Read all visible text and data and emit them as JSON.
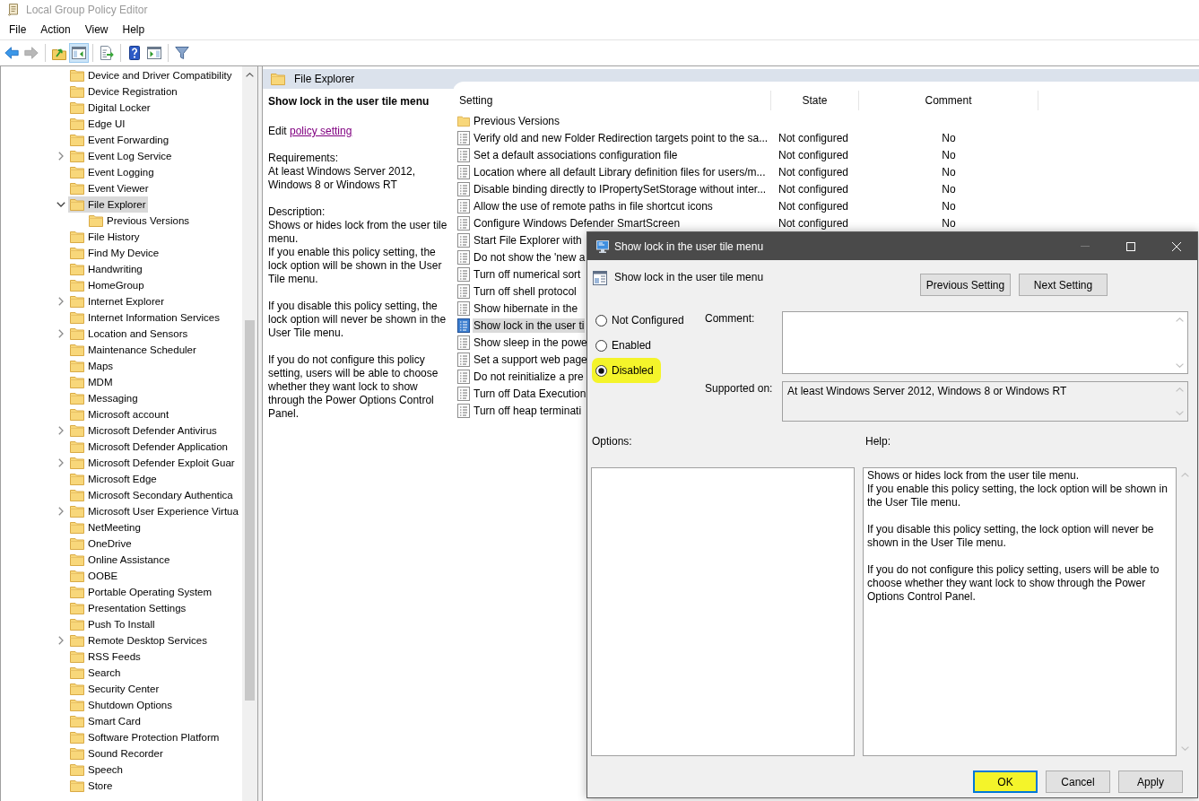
{
  "window": {
    "title": "Local Group Policy Editor"
  },
  "menu": [
    "File",
    "Action",
    "View",
    "Help"
  ],
  "toolbar": [
    {
      "buttons": [
        {
          "kind": "back",
          "pressed": false,
          "disabled": false
        },
        {
          "kind": "forward",
          "pressed": false,
          "disabled": true
        }
      ]
    },
    {
      "buttons": [
        {
          "kind": "up",
          "pressed": false,
          "disabled": false
        },
        {
          "kind": "console_tree",
          "pressed": true,
          "disabled": false
        }
      ]
    },
    {
      "buttons": [
        {
          "kind": "export",
          "pressed": false,
          "disabled": false
        }
      ]
    },
    {
      "buttons": [
        {
          "kind": "help",
          "pressed": false,
          "disabled": false
        },
        {
          "kind": "action_pane",
          "pressed": false,
          "disabled": false
        }
      ]
    },
    {
      "buttons": [
        {
          "kind": "filter",
          "pressed": false,
          "disabled": false
        }
      ]
    }
  ],
  "tree": {
    "items": [
      {
        "label": "Device and Driver Compatibility",
        "kind": "leaf",
        "expanded": false,
        "selected": false
      },
      {
        "label": "Device Registration",
        "kind": "leaf",
        "expanded": false,
        "selected": false
      },
      {
        "label": "Digital Locker",
        "kind": "leaf",
        "expanded": false,
        "selected": false
      },
      {
        "label": "Edge UI",
        "kind": "leaf",
        "expanded": false,
        "selected": false
      },
      {
        "label": "Event Forwarding",
        "kind": "leaf",
        "expanded": false,
        "selected": false
      },
      {
        "label": "Event Log Service",
        "kind": "branch",
        "expanded": false,
        "selected": false
      },
      {
        "label": "Event Logging",
        "kind": "leaf",
        "expanded": false,
        "selected": false
      },
      {
        "label": "Event Viewer",
        "kind": "leaf",
        "expanded": false,
        "selected": false
      },
      {
        "label": "File Explorer",
        "kind": "branch",
        "expanded": true,
        "selected": true,
        "children": [
          {
            "label": "Previous Versions",
            "kind": "leaf",
            "expanded": false,
            "selected": false
          }
        ]
      },
      {
        "label": "File History",
        "kind": "leaf",
        "expanded": false,
        "selected": false
      },
      {
        "label": "Find My Device",
        "kind": "leaf",
        "expanded": false,
        "selected": false
      },
      {
        "label": "Handwriting",
        "kind": "leaf",
        "expanded": false,
        "selected": false
      },
      {
        "label": "HomeGroup",
        "kind": "leaf",
        "expanded": false,
        "selected": false
      },
      {
        "label": "Internet Explorer",
        "kind": "branch",
        "expanded": false,
        "selected": false
      },
      {
        "label": "Internet Information Services",
        "kind": "leaf",
        "expanded": false,
        "selected": false
      },
      {
        "label": "Location and Sensors",
        "kind": "branch",
        "expanded": false,
        "selected": false
      },
      {
        "label": "Maintenance Scheduler",
        "kind": "leaf",
        "expanded": false,
        "selected": false
      },
      {
        "label": "Maps",
        "kind": "leaf",
        "expanded": false,
        "selected": false
      },
      {
        "label": "MDM",
        "kind": "leaf",
        "expanded": false,
        "selected": false
      },
      {
        "label": "Messaging",
        "kind": "leaf",
        "expanded": false,
        "selected": false
      },
      {
        "label": "Microsoft account",
        "kind": "leaf",
        "expanded": false,
        "selected": false
      },
      {
        "label": "Microsoft Defender Antivirus",
        "kind": "branch",
        "expanded": false,
        "selected": false
      },
      {
        "label": "Microsoft Defender Application",
        "kind": "leaf",
        "expanded": false,
        "selected": false
      },
      {
        "label": "Microsoft Defender Exploit Guar",
        "kind": "branch",
        "expanded": false,
        "selected": false
      },
      {
        "label": "Microsoft Edge",
        "kind": "leaf",
        "expanded": false,
        "selected": false
      },
      {
        "label": "Microsoft Secondary Authentica",
        "kind": "leaf",
        "expanded": false,
        "selected": false
      },
      {
        "label": "Microsoft User Experience Virtua",
        "kind": "branch",
        "expanded": false,
        "selected": false
      },
      {
        "label": "NetMeeting",
        "kind": "leaf",
        "expanded": false,
        "selected": false
      },
      {
        "label": "OneDrive",
        "kind": "leaf",
        "expanded": false,
        "selected": false
      },
      {
        "label": "Online Assistance",
        "kind": "leaf",
        "expanded": false,
        "selected": false
      },
      {
        "label": "OOBE",
        "kind": "leaf",
        "expanded": false,
        "selected": false
      },
      {
        "label": "Portable Operating System",
        "kind": "leaf",
        "expanded": false,
        "selected": false
      },
      {
        "label": "Presentation Settings",
        "kind": "leaf",
        "expanded": false,
        "selected": false
      },
      {
        "label": "Push To Install",
        "kind": "leaf",
        "expanded": false,
        "selected": false
      },
      {
        "label": "Remote Desktop Services",
        "kind": "branch",
        "expanded": false,
        "selected": false
      },
      {
        "label": "RSS Feeds",
        "kind": "leaf",
        "expanded": false,
        "selected": false
      },
      {
        "label": "Search",
        "kind": "leaf",
        "expanded": false,
        "selected": false
      },
      {
        "label": "Security Center",
        "kind": "leaf",
        "expanded": false,
        "selected": false
      },
      {
        "label": "Shutdown Options",
        "kind": "leaf",
        "expanded": false,
        "selected": false
      },
      {
        "label": "Smart Card",
        "kind": "leaf",
        "expanded": false,
        "selected": false
      },
      {
        "label": "Software Protection Platform",
        "kind": "leaf",
        "expanded": false,
        "selected": false
      },
      {
        "label": "Sound Recorder",
        "kind": "leaf",
        "expanded": false,
        "selected": false
      },
      {
        "label": "Speech",
        "kind": "leaf",
        "expanded": false,
        "selected": false
      },
      {
        "label": "Store",
        "kind": "leaf",
        "expanded": false,
        "selected": false
      }
    ]
  },
  "details": {
    "header": "File Explorer",
    "extended": {
      "title": "Show lock in the user tile menu",
      "edit_prefix": "Edit",
      "edit_link": "policy setting",
      "requirements_label": "Requirements:",
      "requirements": "At least Windows Server 2012, Windows 8 or Windows RT",
      "description_label": "Description:",
      "description": [
        [
          "Shows or hides lock from the user tile menu.",
          "If you enable this policy setting, the lock option will be shown in the User Tile menu."
        ],
        [
          "If you disable this policy setting, the lock option will never be shown in the User Tile menu."
        ],
        [
          "If you do not configure this policy setting, users will be able to choose whether they want lock to show through the Power Options Control Panel."
        ]
      ]
    },
    "list": {
      "columns": [
        "Setting",
        "State",
        "Comment"
      ],
      "rows": [
        {
          "kind": "folder",
          "name": "Previous Versions",
          "selected": false
        },
        {
          "kind": "policy",
          "name": "Verify old and new Folder Redirection targets point to the sa...",
          "state": "Not configured",
          "comment": "No",
          "selected": false
        },
        {
          "kind": "policy",
          "name": "Set a default associations configuration file",
          "state": "Not configured",
          "comment": "No",
          "selected": false
        },
        {
          "kind": "policy",
          "name": "Location where all default Library definition files for users/m...",
          "state": "Not configured",
          "comment": "No",
          "selected": false
        },
        {
          "kind": "policy",
          "name": "Disable binding directly to IPropertySetStorage without inter...",
          "state": "Not configured",
          "comment": "No",
          "selected": false
        },
        {
          "kind": "policy",
          "name": "Allow the use of remote paths in file shortcut icons",
          "state": "Not configured",
          "comment": "No",
          "selected": false
        },
        {
          "kind": "policy",
          "name": "Configure Windows Defender SmartScreen",
          "state": "Not configured",
          "comment": "No",
          "selected": false
        },
        {
          "kind": "policy",
          "name": "Start File Explorer with",
          "selected": false
        },
        {
          "kind": "policy",
          "name": "Do not show the 'new a",
          "selected": false
        },
        {
          "kind": "policy",
          "name": "Turn off numerical sort",
          "selected": false
        },
        {
          "kind": "policy",
          "name": "Turn off shell protocol",
          "selected": false
        },
        {
          "kind": "policy",
          "name": "Show hibernate in the",
          "selected": false
        },
        {
          "kind": "policy",
          "name": "Show lock in the user ti",
          "selected": true
        },
        {
          "kind": "policy",
          "name": "Show sleep in the powe",
          "selected": false
        },
        {
          "kind": "policy",
          "name": "Set a support web page",
          "selected": false
        },
        {
          "kind": "policy",
          "name": "Do not reinitialize a pre",
          "selected": false
        },
        {
          "kind": "policy",
          "name": "Turn off Data Execution",
          "selected": false
        },
        {
          "kind": "policy",
          "name": "Turn off heap terminati",
          "selected": false
        }
      ]
    }
  },
  "dialog": {
    "title": "Show lock in the user tile menu",
    "title_buttons": [
      {
        "kind": "minimize",
        "disabled": true
      },
      {
        "kind": "maximize",
        "disabled": false
      },
      {
        "kind": "close",
        "disabled": false
      }
    ],
    "heading": "Show lock in the user tile menu",
    "nav_buttons": [
      "Previous Setting",
      "Next Setting"
    ],
    "options": [
      {
        "label": "Not Configured",
        "selected": false,
        "highlighted": false
      },
      {
        "label": "Enabled",
        "selected": false,
        "highlighted": false
      },
      {
        "label": "Disabled",
        "selected": true,
        "highlighted": true
      }
    ],
    "comment_label": "Comment:",
    "supported_label": "Supported on:",
    "supported_value": "At least Windows Server 2012, Windows 8 or Windows RT",
    "options_label": "Options:",
    "help_label": "Help:",
    "help": [
      [
        "Shows or hides lock from the user tile menu.",
        "If you enable this policy setting, the lock option will be shown in the User Tile menu."
      ],
      [
        "If you disable this policy setting, the lock option will never be shown in the User Tile menu."
      ],
      [
        "If you do not configure this policy setting, users will be able to choose whether they want lock to show through the Power Options Control Panel."
      ]
    ],
    "buttons": [
      {
        "label": "OK",
        "default": true,
        "highlighted": true
      },
      {
        "label": "Cancel",
        "default": false,
        "highlighted": false
      },
      {
        "label": "Apply",
        "default": false,
        "highlighted": false
      }
    ]
  }
}
